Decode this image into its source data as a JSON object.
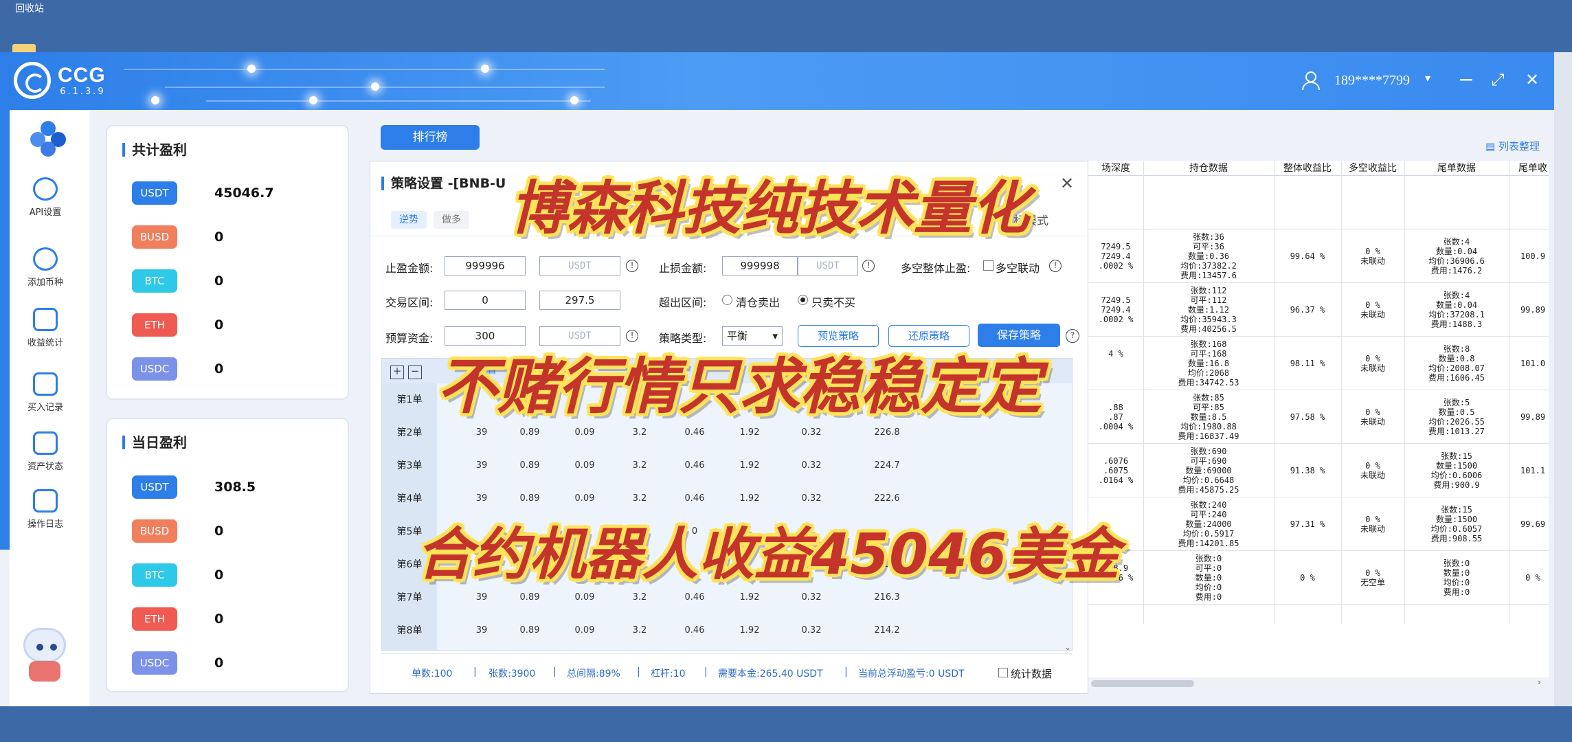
{
  "desktop": {
    "recycle_bin": "回收站"
  },
  "app": {
    "logo_name": "CCG",
    "version": "6.1.3.9",
    "user": "189****7799",
    "window": {
      "min": "−",
      "max": "⤢",
      "close": "✕"
    }
  },
  "nav": [
    {
      "label": "API设置",
      "icon": "gear-icon"
    },
    {
      "label": "添加币种",
      "icon": "add-coin-icon"
    },
    {
      "label": "收益统计",
      "icon": "chart-icon"
    },
    {
      "label": "买入记录",
      "icon": "record-icon"
    },
    {
      "label": "资产状态",
      "icon": "wallet-icon"
    },
    {
      "label": "操作日志",
      "icon": "log-icon"
    }
  ],
  "total_profit": {
    "title": "共计盈利",
    "coins": [
      {
        "name": "USDT",
        "value": "45046.7",
        "color": "#2d7ee8"
      },
      {
        "name": "BUSD",
        "value": "0",
        "color": "#f17f5e"
      },
      {
        "name": "BTC",
        "value": "0",
        "color": "#2ec8e8"
      },
      {
        "name": "ETH",
        "value": "0",
        "color": "#ef5a52"
      },
      {
        "name": "USDC",
        "value": "0",
        "color": "#7b92e8"
      }
    ]
  },
  "daily_profit": {
    "title": "当日盈利",
    "coins": [
      {
        "name": "USDT",
        "value": "308.5",
        "color": "#2d7ee8"
      },
      {
        "name": "BUSD",
        "value": "0",
        "color": "#f17f5e"
      },
      {
        "name": "BTC",
        "value": "0",
        "color": "#2ec8e8"
      },
      {
        "name": "ETH",
        "value": "0",
        "color": "#ef5a52"
      },
      {
        "name": "USDC",
        "value": "0",
        "color": "#7b92e8"
      }
    ]
  },
  "rank_button": "排行榜",
  "strategy": {
    "title": "策略设置 -[BNB-U",
    "tab_trend": "逆势",
    "tab_long": "做多",
    "mode_suffix": "标模式",
    "tp_label": "止盈金额:",
    "tp_value": "999996",
    "tp_unit": "USDT",
    "sl_label": "止损金额:",
    "sl_value": "999998",
    "sl_unit": "USDT",
    "ls_stop_label": "多空整体止盈:",
    "ls_link_label": "多空联动",
    "range_label": "交易区间:",
    "range_low": "0",
    "range_high": "297.5",
    "exceed_label": "超出区间:",
    "opt_clear": "清仓卖出",
    "opt_sell_only": "只卖不买",
    "budget_label": "预算资金:",
    "budget_value": "300",
    "budget_unit": "USDT",
    "type_label": "策略类型:",
    "type_value": "平衡",
    "btn_preview": "预览策略",
    "btn_restore": "还原策略",
    "btn_save": "保存策略",
    "help": "?",
    "head_auto": "自",
    "head_ratio": "比",
    "rows": [
      {
        "label": "第1单",
        "cells": [
          "",
          "",
          "",
          "",
          "",
          "",
          "",
          ""
        ]
      },
      {
        "label": "第2单",
        "cells": [
          "39",
          "0.89",
          "0.09",
          "3.2",
          "0.46",
          "1.92",
          "0.32",
          "226.8"
        ]
      },
      {
        "label": "第3单",
        "cells": [
          "39",
          "0.89",
          "0.09",
          "3.2",
          "0.46",
          "1.92",
          "0.32",
          "224.7"
        ]
      },
      {
        "label": "第4单",
        "cells": [
          "39",
          "0.89",
          "0.09",
          "3.2",
          "0.46",
          "1.92",
          "0.32",
          "222.6"
        ]
      },
      {
        "label": "第5单",
        "cells": [
          "",
          "",
          "",
          "",
          "0",
          "",
          "",
          ""
        ]
      },
      {
        "label": "第6单",
        "cells": [
          "",
          "0",
          "",
          "",
          "",
          "",
          "",
          "218."
        ]
      },
      {
        "label": "第7单",
        "cells": [
          "39",
          "0.89",
          "0.09",
          "3.2",
          "0.46",
          "1.92",
          "0.32",
          "216.3"
        ]
      },
      {
        "label": "第8单",
        "cells": [
          "39",
          "0.89",
          "0.09",
          "3.2",
          "0.46",
          "1.92",
          "0.32",
          "214.2"
        ]
      }
    ],
    "summary": {
      "orders": "单数:100",
      "sheets": "张数:3900",
      "gap": "总间隔:89%",
      "leverage": "杠杆:10",
      "capital": "需要本金:265.40 USDT",
      "floating": "当前总浮动盈亏:0 USDT",
      "stats": "统计数据",
      "sep": "|"
    }
  },
  "right_table": {
    "link": "列表整理",
    "headers": [
      "场深度",
      "持仓数据",
      "整体收益比",
      "多空收益比",
      "尾单数据",
      "尾单收"
    ],
    "rows": [
      {
        "depth": [],
        "pos": [],
        "total": "",
        "ls": [],
        "tail": [],
        "tailr": ""
      },
      {
        "depth": [
          "7249.5",
          "7249.4",
          ".0002 %"
        ],
        "pos": [
          "张数:36",
          "可平:36",
          "数量:0.36",
          "均价:37382.2",
          "费用:13457.6"
        ],
        "total": "99.64 %",
        "ls": [
          "0 %",
          "未联动"
        ],
        "tail": [
          "张数:4",
          "数量:0.04",
          "均价:36906.6",
          "费用:1476.2"
        ],
        "tailr": "100.9"
      },
      {
        "depth": [
          "7249.5",
          "7249.4",
          ".0002 %"
        ],
        "pos": [
          "张数:112",
          "可平:112",
          "数量:1.12",
          "均价:35943.3",
          "费用:40256.5"
        ],
        "total": "96.37 %",
        "ls": [
          "0 %",
          "未联动"
        ],
        "tail": [
          "张数:4",
          "数量:0.04",
          "均价:37208.1",
          "费用:1488.3"
        ],
        "tailr": "99.89"
      },
      {
        "depth": [
          "",
          "",
          "4 %"
        ],
        "pos": [
          "张数:168",
          "可平:168",
          "数量:16.8",
          "均价:2068",
          "费用:34742.53"
        ],
        "total": "98.11 %",
        "ls": [
          "0 %",
          "未联动"
        ],
        "tail": [
          "张数:8",
          "数量:0.8",
          "均价:2008.07",
          "费用:1606.45"
        ],
        "tailr": "101.0"
      },
      {
        "depth": [
          ".88",
          ".87",
          ".0004 %"
        ],
        "pos": [
          "张数:85",
          "可平:85",
          "数量:8.5",
          "均价:1980.88",
          "费用:16837.49"
        ],
        "total": "97.58 %",
        "ls": [
          "0 %",
          "未联动"
        ],
        "tail": [
          "张数:5",
          "数量:0.5",
          "均价:2026.55",
          "费用:1013.27"
        ],
        "tailr": "99.89"
      },
      {
        "depth": [
          ".6076",
          ".6075",
          ".0164 %"
        ],
        "pos": [
          "张数:690",
          "可平:690",
          "数量:69000",
          "均价:0.6648",
          "费用:45875.25"
        ],
        "total": "91.38 %",
        "ls": [
          "0 %",
          "未联动"
        ],
        "tail": [
          "张数:15",
          "数量:1500",
          "均价:0.6006",
          "费用:900.9"
        ],
        "tailr": "101.1"
      },
      {
        "depth": [
          "",
          "",
          ""
        ],
        "pos": [
          "张数:240",
          "可平:240",
          "数量:24000",
          "均价:0.5917",
          "费用:14201.85"
        ],
        "total": "97.31 %",
        "ls": [
          "0 %",
          "未联动"
        ],
        "tail": [
          "张数:15",
          "数量:1500",
          "均价:0.6057",
          "费用:908.55"
        ],
        "tailr": "99.69"
      },
      {
        "depth": [
          "",
          "228.9",
          ".0436 %"
        ],
        "pos": [
          "张数:0",
          "可平:0",
          "数量:0",
          "均价:0",
          "费用:0"
        ],
        "total": "0 %",
        "ls": [
          "0 %",
          "无空单"
        ],
        "tail": [
          "张数:0",
          "数量:0",
          "均价:0",
          "费用:0"
        ],
        "tailr": "0 %"
      }
    ]
  },
  "overlay": {
    "line1": "博森科技纯技术量化",
    "line2": "不赌行情只求稳稳定定",
    "line3": "合约机器人收益45046美金"
  }
}
